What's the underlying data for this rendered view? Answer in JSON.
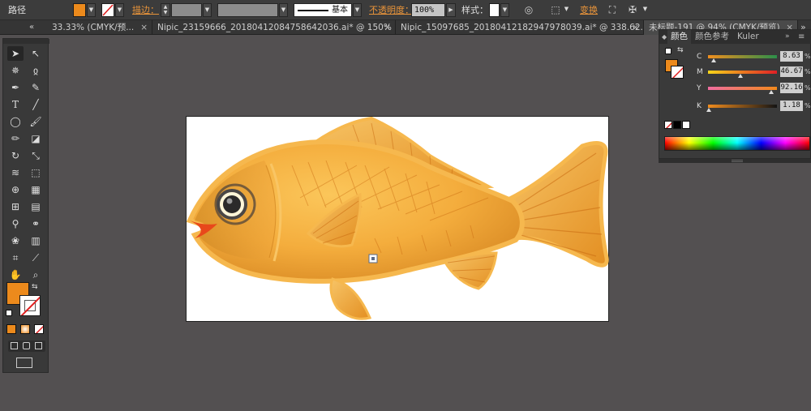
{
  "control_bar": {
    "object_type": "路径",
    "stroke_label": "描边：",
    "stroke_style": "基本",
    "opacity_label": "不透明度：",
    "opacity_value": "100%",
    "style_label": "样式：",
    "transform_label": "变换",
    "fill_color": "#ec8a1c"
  },
  "tabs": [
    {
      "label": "33.33% (CMYK/预...",
      "close": "×"
    },
    {
      "label": "Nipic_23159666_20180412084758642036.ai* @ 150% (R...",
      "close": "×"
    },
    {
      "label": "Nipic_15097685_20180412182947978039.ai* @ 338.62...",
      "close": "×"
    },
    {
      "label": "未标题-191 @ 94% (CMYK/预览)",
      "close": "×"
    }
  ],
  "tabs_overflow": "»",
  "tools_fill_color": "#ec8a1c",
  "color_panel": {
    "tabs": [
      "颜色",
      "颜色参考",
      "Kuler"
    ],
    "channels": [
      {
        "name": "C",
        "value": "8.63",
        "fraction": 0.0863,
        "track": "linear-gradient(to right,#f08f1e,#2b8f4a)"
      },
      {
        "name": "M",
        "value": "46.67",
        "fraction": 0.4667,
        "track": "linear-gradient(to right,#f7d51a,#e01f26)"
      },
      {
        "name": "Y",
        "value": "92.16",
        "fraction": 0.9216,
        "track": "linear-gradient(to right,#f06da0,#f1891b)"
      },
      {
        "name": "K",
        "value": "1.18",
        "fraction": 0.0118,
        "track": "linear-gradient(to right,#f08c1e,#141414)"
      }
    ],
    "pct": "%",
    "fill_color": "#ec8a1c"
  },
  "fish": {
    "body_light": "#fbc65a",
    "body_dark": "#d98a24",
    "fin": "#f2a43a",
    "outline": "#f6b84e",
    "stroke": "#c96a10",
    "mouth": "#e8481b",
    "eye": "#4a4746"
  }
}
